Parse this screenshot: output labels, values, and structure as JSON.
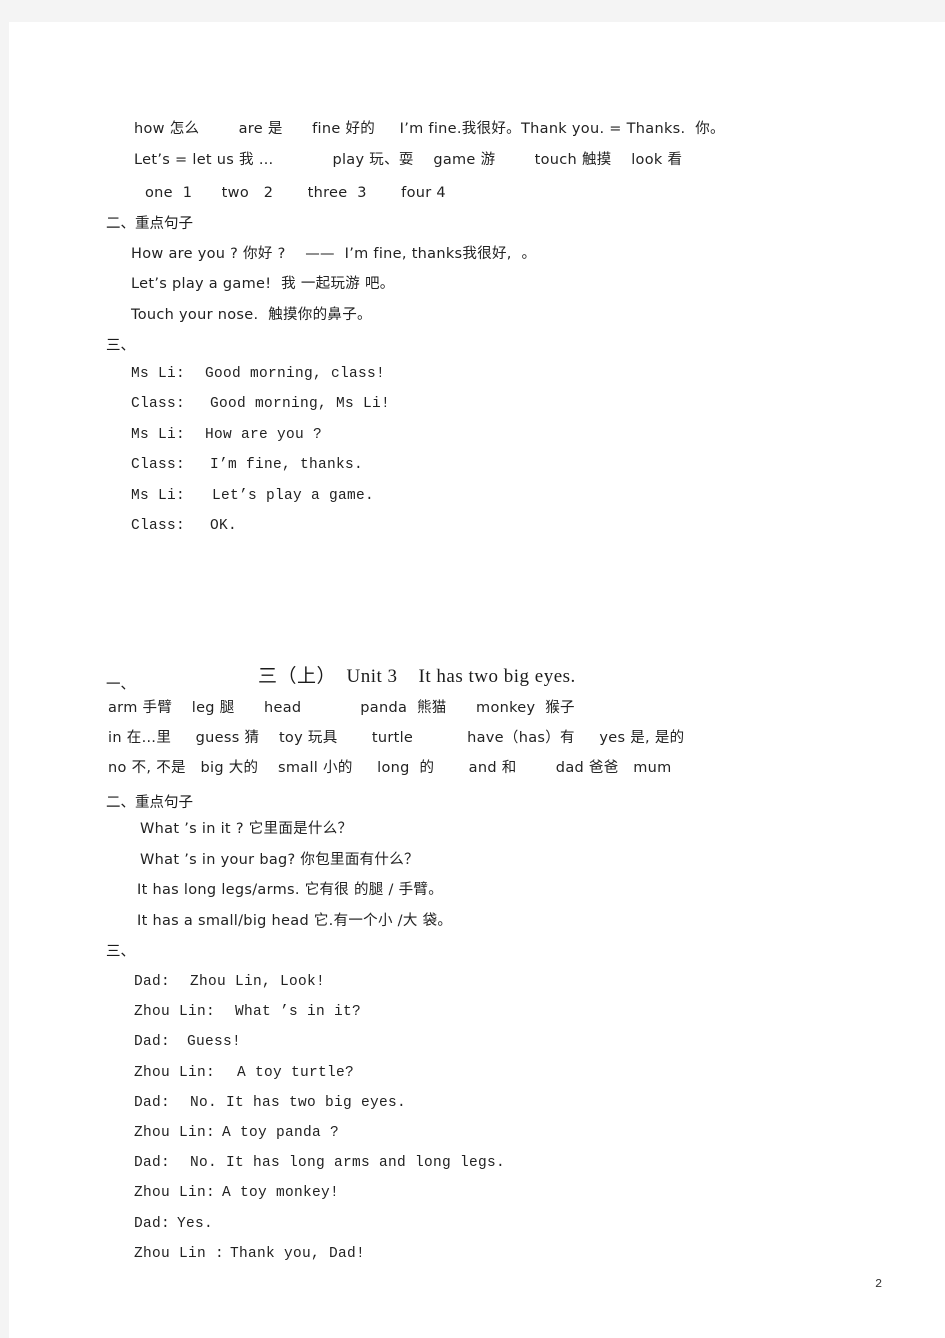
{
  "document": {
    "page_number": "2",
    "background_color": "#f4f4f4",
    "page_color": "#ffffff",
    "text_color": "#222222"
  },
  "unit2": {
    "vocab_heading": "",
    "vocab_rows": [
      "how 怎么        are 是      fine 好的     I’m fine.我很好。Thank you. = Thanks.  你。",
      "Let’s = let us 我 …            play 玩、耍    game 游        touch 触摸    look 看",
      "one  1      two   2       three  3       four 4"
    ],
    "sentences_heading": "二、重点句子",
    "sentences": [
      "How are you ? 你好 ?    ——  I’m fine, thanks我很好,  。",
      "Let’s play a game!  我 一起玩游 吧。",
      "Touch your nose.  触摸你的鼻子。"
    ],
    "dialogue_heading": "三、",
    "dialogue": [
      {
        "speaker": "Ms Li:",
        "text": "Good morning, class!"
      },
      {
        "speaker": "Class:",
        "text": "Good morning, Ms Li!"
      },
      {
        "speaker": "Ms Li:",
        "text": "How are you ?"
      },
      {
        "speaker": "Class:",
        "text": "I’m fine, thanks."
      },
      {
        "speaker": "Ms Li:",
        "text": "Let’s play a game."
      },
      {
        "speaker": "Class:",
        "text": "OK."
      }
    ]
  },
  "unit3": {
    "title_grade": "三（上）",
    "title_unit": "Unit 3",
    "title_sentence": "It has two big eyes.",
    "vocab_heading": "一、",
    "vocab_rows": [
      "arm 手臂    leg 腿      head            panda  熊猫      monkey  猴子",
      "in 在…里     guess 猜    toy 玩具       turtle           have（has）有     yes 是, 是的",
      "no 不, 不是   big 大的    small 小的     long  的       and 和        dad 爸爸   mum"
    ],
    "sentences_heading": "二、重点句子",
    "sentences": [
      "What ’s in it ? 它里面是什么？",
      "What ’s in your bag? 你包里面有什么？",
      "It has long legs/arms. 它有很 的腿 / 手臂。",
      "It has a small/big head 它.有一个小 /大 袋。"
    ],
    "dialogue_heading": "三、",
    "dialogue": [
      {
        "speaker": "Dad:",
        "text": "Zhou Lin, Look!"
      },
      {
        "speaker": "Zhou Lin:",
        "text": "What ’s in it?"
      },
      {
        "speaker": "Dad:",
        "text": "Guess!"
      },
      {
        "speaker": "Zhou Lin:",
        "text": "A toy turtle?"
      },
      {
        "speaker": "Dad:",
        "text": "No. It has two big eyes."
      },
      {
        "speaker": "Zhou Lin:",
        "text": "A toy panda ?"
      },
      {
        "speaker": "Dad:",
        "text": "No. It has long arms and long legs."
      },
      {
        "speaker": "Zhou Lin:",
        "text": "A toy monkey!"
      },
      {
        "speaker": "Dad:",
        "text": "Yes."
      },
      {
        "speaker": "Zhou Lin :",
        "text": "Thank you, Dad!"
      }
    ]
  }
}
